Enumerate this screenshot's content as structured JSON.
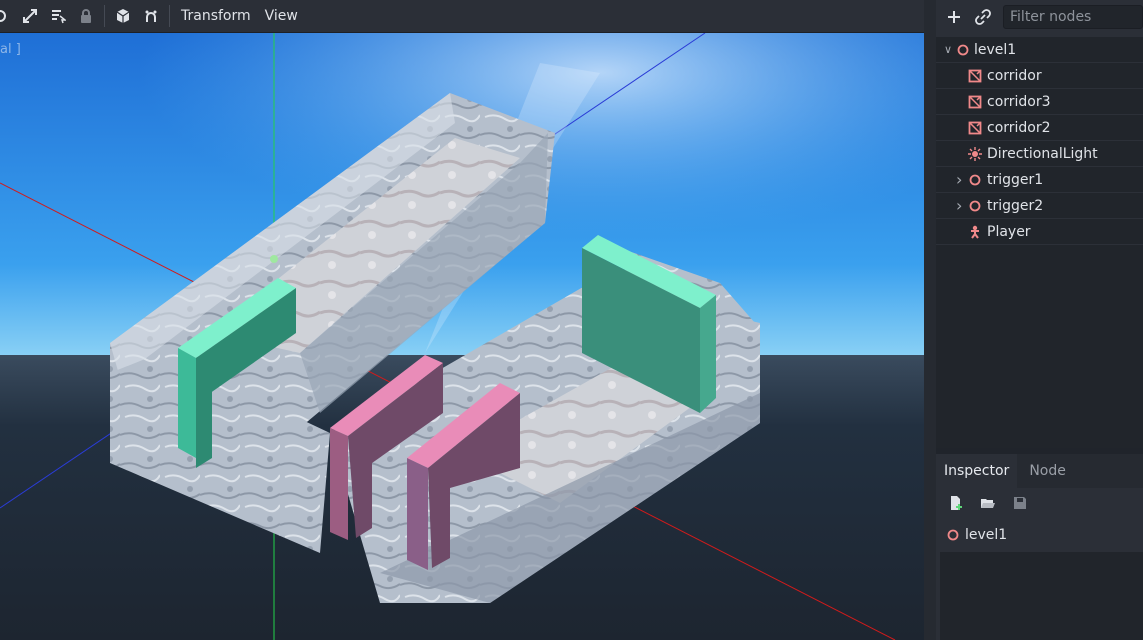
{
  "toolbar": {
    "tools": [
      {
        "icon": "rotate-icon"
      },
      {
        "icon": "scale-icon"
      },
      {
        "icon": "list-select-icon"
      },
      {
        "icon": "lock-icon"
      },
      {
        "icon": "cube-icon"
      },
      {
        "icon": "snap-icon"
      }
    ],
    "menus": [
      "Transform",
      "View"
    ]
  },
  "viewport": {
    "mode_label": "al ]",
    "colors": {
      "x_axis": "#d11b1b",
      "y_axis": "#22d24a",
      "z_axis": "#2a3cd6",
      "trigger_green": "#3dba98",
      "trigger_pink": "#c86a9a",
      "sky": "#2a86e8",
      "ground": "#1f2933"
    }
  },
  "scene": {
    "filter_placeholder": "Filter nodes",
    "nodes": [
      {
        "label": "level1",
        "icon": "node-circle-icon",
        "color": "#f0898a",
        "depth": 0,
        "expander": "expanded"
      },
      {
        "label": "corridor",
        "icon": "mesh-instance-icon",
        "color": "#f0898a",
        "depth": 1,
        "expander": ""
      },
      {
        "label": "corridor3",
        "icon": "mesh-instance-icon",
        "color": "#f0898a",
        "depth": 1,
        "expander": ""
      },
      {
        "label": "corridor2",
        "icon": "mesh-instance-icon",
        "color": "#f0898a",
        "depth": 1,
        "expander": ""
      },
      {
        "label": "DirectionalLight",
        "icon": "light-icon",
        "color": "#f0898a",
        "depth": 1,
        "expander": ""
      },
      {
        "label": "trigger1",
        "icon": "node-circle-icon",
        "color": "#f0898a",
        "depth": 1,
        "expander": "collapsed"
      },
      {
        "label": "trigger2",
        "icon": "node-circle-icon",
        "color": "#f0898a",
        "depth": 1,
        "expander": "collapsed"
      },
      {
        "label": "Player",
        "icon": "player-icon",
        "color": "#f0898a",
        "depth": 1,
        "expander": ""
      }
    ]
  },
  "inspector": {
    "tabs": [
      "Inspector",
      "Node"
    ],
    "tools": [
      {
        "icon": "new-resource-icon"
      },
      {
        "icon": "open-folder-icon"
      },
      {
        "icon": "save-icon"
      }
    ],
    "object": "level1"
  }
}
